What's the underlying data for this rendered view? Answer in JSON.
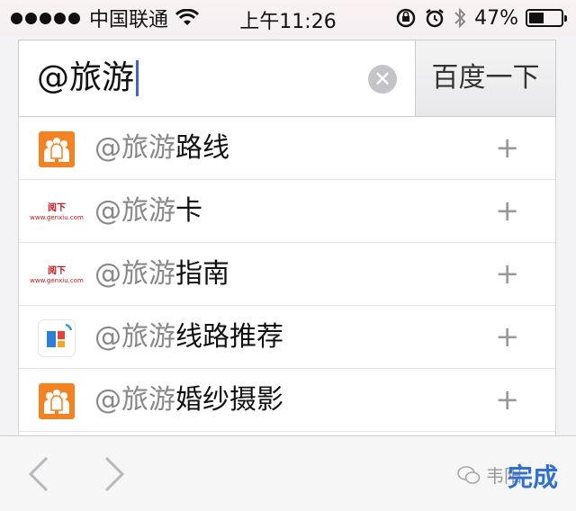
{
  "status_bar": {
    "carrier": "中国联通",
    "time": "上午11:26",
    "battery_percent": "47%",
    "battery_level": 0.47,
    "icons": [
      "signal-dots-icon",
      "wifi-icon",
      "orientation-lock-icon",
      "alarm-icon",
      "bluetooth-icon",
      "battery-icon"
    ]
  },
  "search": {
    "query": "@旅游",
    "clear_icon": "clear-icon",
    "button_label": "百度一下"
  },
  "suggestions": [
    {
      "prefix": "@旅游",
      "rest": "路线",
      "icon": "orange-people-icon",
      "plus_icon": "add-icon"
    },
    {
      "prefix": "@旅游",
      "rest": "卡",
      "icon": "genxiu-logo-icon",
      "logo_text": "阅下",
      "logo_sub": "www.genxiu.com",
      "plus_icon": "add-icon"
    },
    {
      "prefix": "@旅游",
      "rest": "指南",
      "icon": "genxiu-logo-icon",
      "logo_text": "阅下",
      "logo_sub": "www.genxiu.com",
      "plus_icon": "add-icon"
    },
    {
      "prefix": "@旅游",
      "rest": "线路推荐",
      "icon": "map-app-icon",
      "plus_icon": "add-icon"
    },
    {
      "prefix": "@旅游",
      "rest": "婚纱摄影",
      "icon": "orange-people-icon",
      "plus_icon": "add-icon"
    }
  ],
  "toolbar": {
    "prev_icon": "chevron-left-icon",
    "next_icon": "chevron-right-icon",
    "watermark": "韦阳",
    "done_label": "完成"
  },
  "colors": {
    "accent": "#2f6fd8",
    "caret": "#3b63d9",
    "orange_icon": "#f58220",
    "genxiu_red": "#c8161d"
  }
}
